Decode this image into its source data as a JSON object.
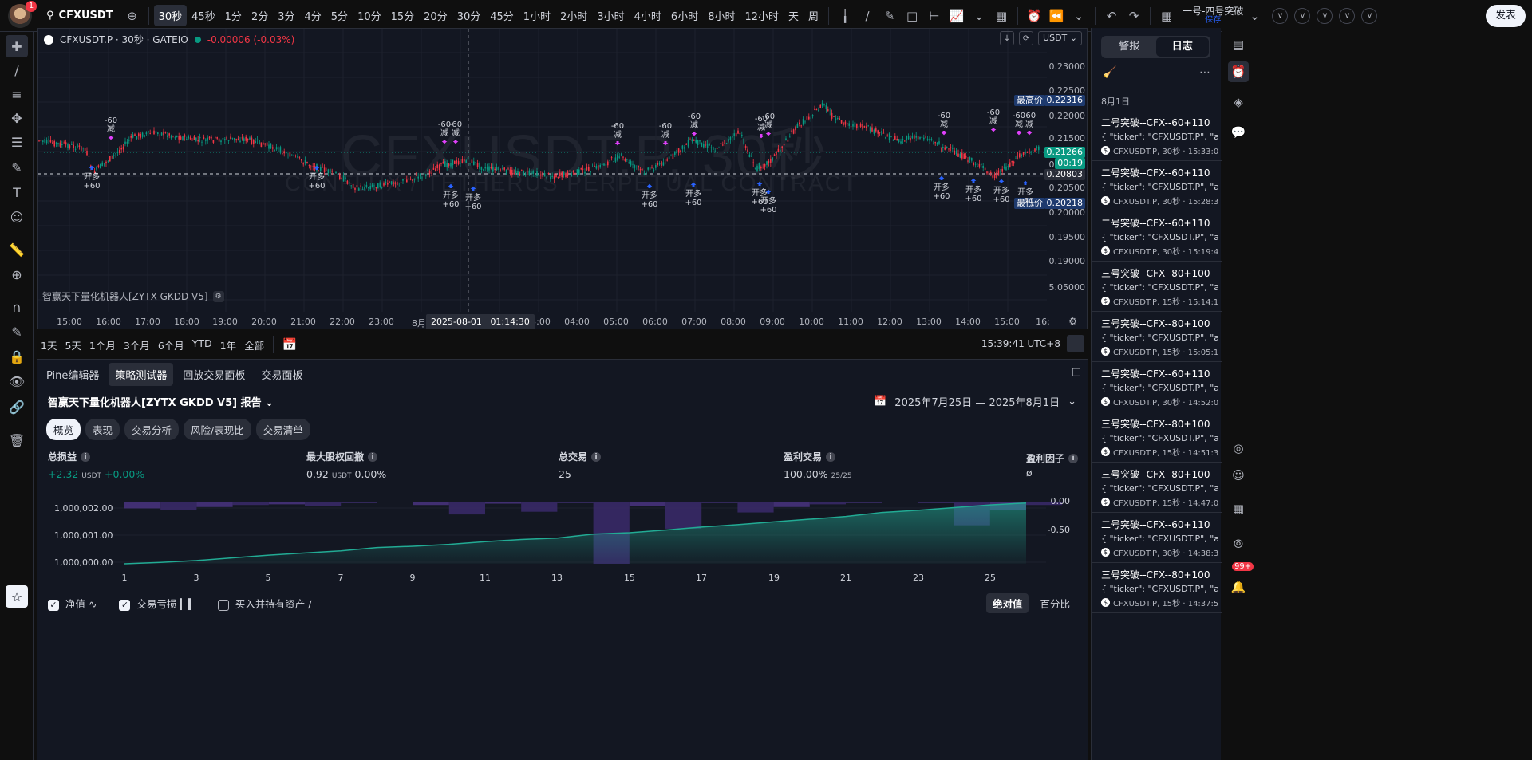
{
  "topbar": {
    "notification_count": "1",
    "symbol": "CFXUSDT",
    "intervals": [
      "30秒",
      "45秒",
      "1分",
      "2分",
      "3分",
      "4分",
      "5分",
      "10分",
      "15分",
      "20分",
      "30分",
      "45分",
      "1小时",
      "2小时",
      "3小时",
      "4小时",
      "6小时",
      "8小时",
      "12小时",
      "天",
      "周"
    ],
    "active_interval": "30秒",
    "layout_name": "一号-四号突破",
    "layout_status": "保存",
    "v_buttons": [
      "v",
      "v",
      "v",
      "v",
      "v"
    ],
    "publish_label": "发表"
  },
  "chart": {
    "symbol_title": "CFXUSDT.P · 30秒 · GATEIO",
    "change": "-0.00006 (-0.03%)",
    "currency": "USDT",
    "watermark_main": "CFXUSDT.P, 30秒",
    "watermark_sub": "CONFLUX / TETHERUS PERPETUAL CONTRACT",
    "indicator_name": "智赢天下量化机器人[ZYTX GKDD V5]",
    "price_ticks": [
      "0.23000",
      "0.22500",
      "0.22000",
      "0.21500",
      "0.21000",
      "0.20500",
      "0.20000",
      "0.19500",
      "0.19000",
      "5.05000"
    ],
    "high_label": "最高价",
    "high_value": "0.22316",
    "low_label": "最低价",
    "low_value": "0.20218",
    "last_price": "0.21266",
    "countdown": "00:19",
    "crosshair_price": "0.20803",
    "time_ticks": [
      "15:00",
      "16:00",
      "17:00",
      "18:00",
      "19:00",
      "20:00",
      "21:00",
      "22:00",
      "23:00",
      "8月",
      "03:00",
      "04:00",
      "05:00",
      "06:00",
      "07:00",
      "08:00",
      "09:00",
      "10:00",
      "11:00",
      "12:00",
      "13:00",
      "14:00",
      "15:00",
      "16:"
    ],
    "crosshair_date": "2025-08-01",
    "crosshair_time": "01:14:30",
    "sig_buy_text": "开多",
    "sig_buy_qty": "+60",
    "sig_sell_text": "减",
    "sig_sell_qty": "-60"
  },
  "rangebar": {
    "ranges": [
      "1天",
      "5天",
      "1个月",
      "3个月",
      "6个月",
      "YTD",
      "1年",
      "全部"
    ],
    "clock": "15:39:41 UTC+8"
  },
  "bottom": {
    "tabs": [
      "Pine编辑器",
      "策略测试器",
      "回放交易面板",
      "交易面板"
    ],
    "active_tab": "策略测试器",
    "report_title": "智赢天下量化机器人[ZYTX GKDD V5] 报告",
    "date_range": "2025年7月25日 — 2025年8月1日",
    "subtabs": [
      "概览",
      "表现",
      "交易分析",
      "风险/表现比",
      "交易清单"
    ],
    "metrics": {
      "net_label": "总损益",
      "net_value": "+2.32",
      "net_unit": "USDT",
      "net_pct": "+0.00%",
      "dd_label": "最大股权回撤",
      "dd_value": "0.92",
      "dd_unit": "USDT",
      "dd_pct": "0.00%",
      "trades_label": "总交易",
      "trades_value": "25",
      "profitable_label": "盈利交易",
      "profitable_value": "100.00%",
      "profitable_ratio": "25/25",
      "pf_label": "盈利因子",
      "pf_value": "ø"
    },
    "equity_left_ticks": [
      "1,000,002.00",
      "1,000,001.00",
      "1,000,000.00"
    ],
    "equity_right_ticks": [
      "0.00",
      "-0.50"
    ],
    "equity_x_ticks": [
      "1",
      "3",
      "5",
      "7",
      "9",
      "11",
      "13",
      "15",
      "17",
      "19",
      "21",
      "23",
      "25"
    ],
    "legend": {
      "equity": "净值",
      "drawdown": "交易亏损",
      "buyhold": "买入并持有资产"
    },
    "mode": {
      "absolute": "绝对值",
      "percent": "百分比"
    }
  },
  "chart_data": {
    "type": "area",
    "x": [
      1,
      2,
      3,
      4,
      5,
      6,
      7,
      8,
      9,
      10,
      11,
      12,
      13,
      14,
      15,
      16,
      17,
      18,
      19,
      20,
      21,
      22,
      23,
      24,
      25,
      26
    ],
    "series": [
      {
        "values": [
          1000000.0,
          1000000.05,
          1000000.12,
          1000000.22,
          1000000.32,
          1000000.4,
          1000000.48,
          1000000.6,
          1000000.65,
          1000000.72,
          1000000.82,
          1000000.9,
          1000000.95,
          1000001.1,
          1000001.15,
          1000001.25,
          1000001.36,
          1000001.45,
          1000001.55,
          1000001.65,
          1000001.75,
          1000001.9,
          1000001.98,
          1000002.08,
          1000002.18,
          1000002.25
        ]
      }
    ],
    "drawdown": [
      -0.1,
      -0.12,
      -0.08,
      -0.05,
      -0.04,
      -0.06,
      -0.02,
      -0.01,
      -0.05,
      -0.19,
      -0.03,
      -0.15,
      -0.02,
      -0.92,
      -0.07,
      -0.4,
      -0.02,
      -0.16,
      -0.08,
      -0.04,
      -0.02,
      -0.01,
      -0.02,
      -0.35,
      -0.13,
      -0.05
    ],
    "ylim": [
      1000000.0,
      1000002.3
    ],
    "y2lim": [
      -0.92,
      0.0
    ]
  },
  "right_panel": {
    "tab_alerts": "警报",
    "tab_log": "日志",
    "date_header": "8月1日",
    "logs": [
      {
        "title": "二号突破--CFX--60+110",
        "body": "{ \"ticker\": \"CFXUSDT.P\", \"a",
        "meta": "CFXUSDT.P, 30秒 · 15:33:0"
      },
      {
        "title": "二号突破--CFX--60+110",
        "body": "{ \"ticker\": \"CFXUSDT.P\", \"a",
        "meta": "CFXUSDT.P, 30秒 · 15:28:3"
      },
      {
        "title": "二号突破--CFX--60+110",
        "body": "{ \"ticker\": \"CFXUSDT.P\", \"a",
        "meta": "CFXUSDT.P, 30秒 · 15:19:4"
      },
      {
        "title": "三号突破--CFX--80+100",
        "body": "{ \"ticker\": \"CFXUSDT.P\", \"a",
        "meta": "CFXUSDT.P, 15秒 · 15:14:1"
      },
      {
        "title": "三号突破--CFX--80+100",
        "body": "{ \"ticker\": \"CFXUSDT.P\", \"a",
        "meta": "CFXUSDT.P, 15秒 · 15:05:1"
      },
      {
        "title": "二号突破--CFX--60+110",
        "body": "{ \"ticker\": \"CFXUSDT.P\", \"a",
        "meta": "CFXUSDT.P, 30秒 · 14:52:0"
      },
      {
        "title": "三号突破--CFX--80+100",
        "body": "{ \"ticker\": \"CFXUSDT.P\", \"a",
        "meta": "CFXUSDT.P, 15秒 · 14:51:3"
      },
      {
        "title": "三号突破--CFX--80+100",
        "body": "{ \"ticker\": \"CFXUSDT.P\", \"a",
        "meta": "CFXUSDT.P, 15秒 · 14:47:0"
      },
      {
        "title": "二号突破--CFX--60+110",
        "body": "{ \"ticker\": \"CFXUSDT.P\", \"a",
        "meta": "CFXUSDT.P, 30秒 · 14:38:3"
      },
      {
        "title": "三号突破--CFX--80+100",
        "body": "{ \"ticker\": \"CFXUSDT.P\", \"a",
        "meta": "CFXUSDT.P, 15秒 · 14:37:5"
      }
    ]
  },
  "right_strip": {
    "badge": "99+"
  },
  "colors": {
    "up": "#089981",
    "down": "#f23645",
    "accent": "#2962ff",
    "sell_marker": "#e040fb"
  }
}
